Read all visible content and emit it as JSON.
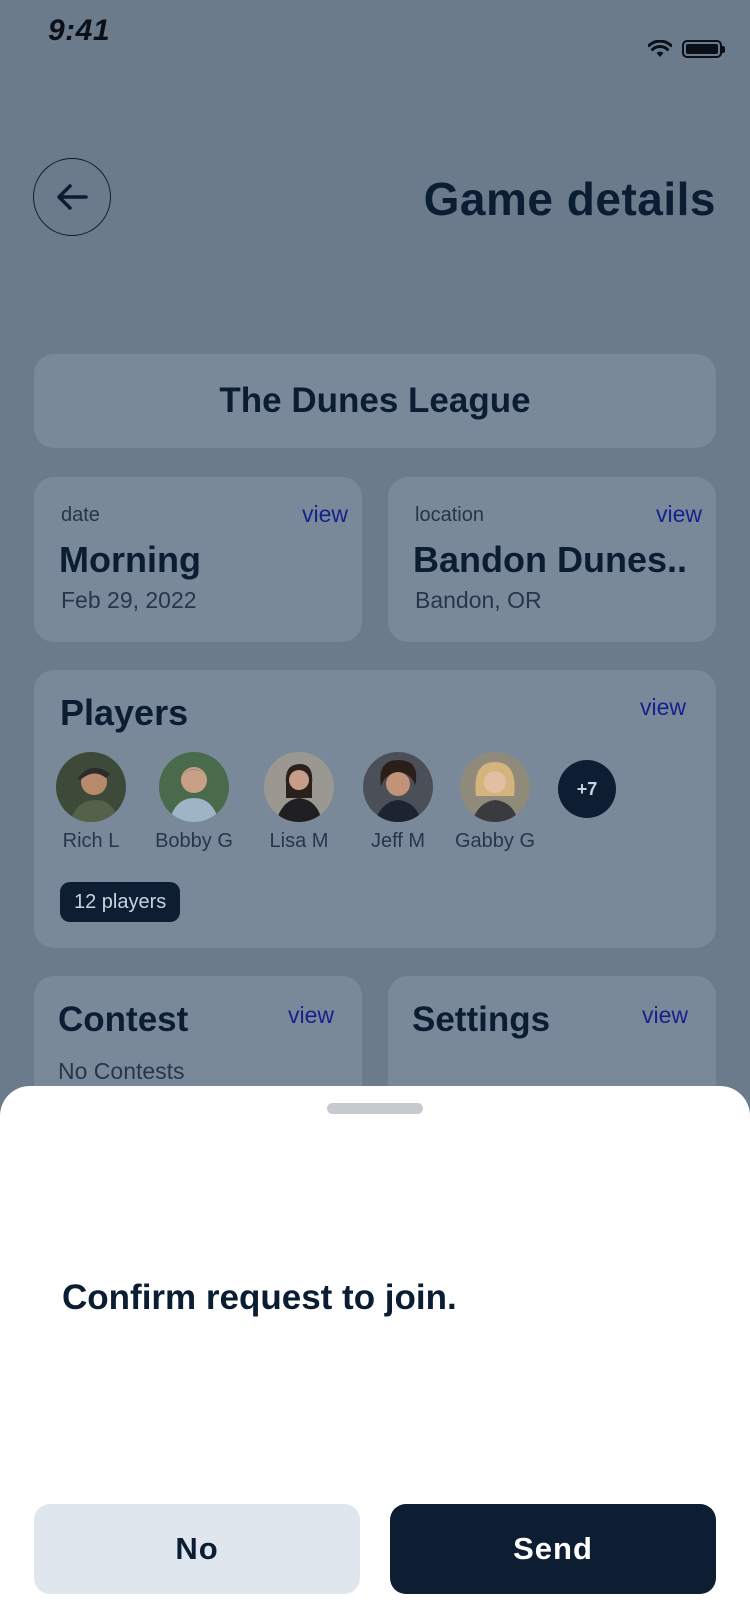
{
  "status_bar": {
    "time": "9:41"
  },
  "header": {
    "title": "Game details"
  },
  "league": {
    "name": "The Dunes League"
  },
  "date_card": {
    "label": "date",
    "view": "view",
    "value": "Morning",
    "sub": "Feb 29, 2022"
  },
  "location_card": {
    "label": "location",
    "view": "view",
    "value": "Bandon Dunes..",
    "sub": "Bandon, OR"
  },
  "players": {
    "title": "Players",
    "view": "view",
    "list": [
      {
        "name": "Rich L"
      },
      {
        "name": "Bobby G"
      },
      {
        "name": "Lisa M"
      },
      {
        "name": "Jeff M"
      },
      {
        "name": "Gabby G"
      }
    ],
    "more": "+7",
    "count": "12 players"
  },
  "contest": {
    "title": "Contest",
    "view": "view",
    "sub": "No Contests"
  },
  "settings": {
    "title": "Settings",
    "view": "view"
  },
  "sheet": {
    "message": "Confirm request to join.",
    "no_label": "No",
    "send_label": "Send"
  },
  "colors": {
    "background": "#6b7b8b",
    "card": "#7a8999",
    "navy": "#0d1e33",
    "link": "#17218d",
    "no_button": "#dfe6ee"
  }
}
